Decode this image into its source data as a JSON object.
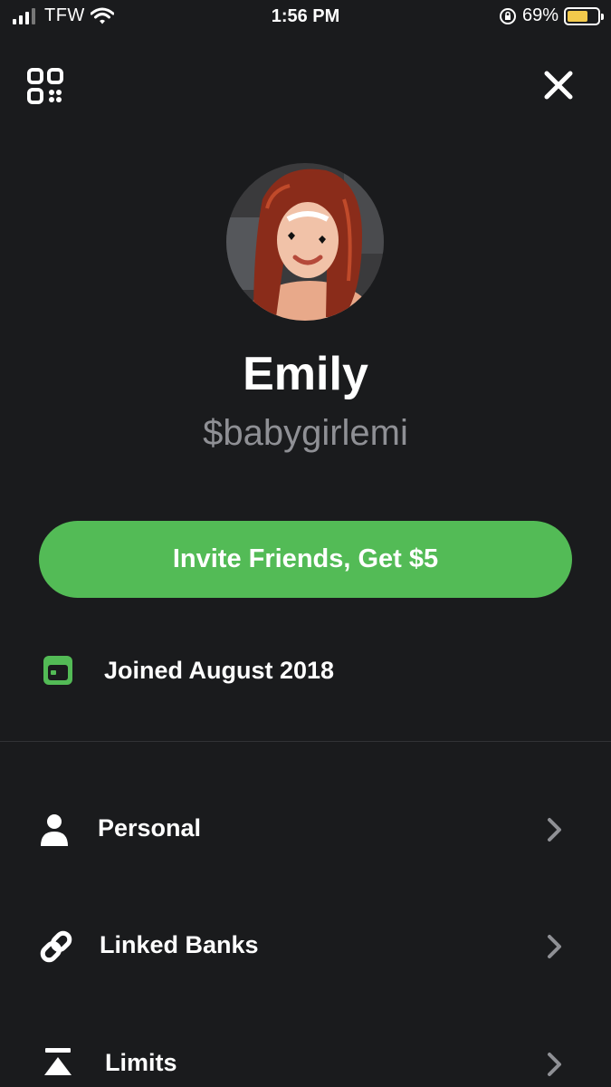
{
  "status_bar": {
    "carrier": "TFW",
    "time": "1:56 PM",
    "battery_percent": "69%",
    "battery_level": 0.69,
    "battery_color": "#f2c94c"
  },
  "header": {
    "left_icon": "qr-code-icon",
    "right_icon": "close-icon"
  },
  "profile": {
    "name": "Emily",
    "cashtag": "$babygirlemi"
  },
  "invite": {
    "label": "Invite Friends, Get $5",
    "color": "#53bb56"
  },
  "joined": {
    "icon": "calendar-icon",
    "label": "Joined August 2018"
  },
  "menu": {
    "items": [
      {
        "label": "Personal",
        "icon": "person-icon"
      },
      {
        "label": "Linked Banks",
        "icon": "link-icon"
      },
      {
        "label": "Limits",
        "icon": "limits-icon"
      }
    ]
  }
}
